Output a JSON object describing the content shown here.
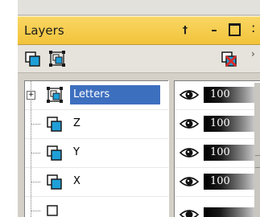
{
  "panel": {
    "title": "Layers",
    "buttons": {
      "pin": "†",
      "minimize": "–",
      "close": "×"
    }
  },
  "toolbar": {
    "icons": [
      "new-layer-icon",
      "new-group-icon",
      "delete-layer-icon"
    ],
    "more": "›"
  },
  "layers": [
    {
      "name": "Letters",
      "expander": "+",
      "selected": true,
      "visible": true,
      "opacity": "100",
      "icon": "group-layer-icon"
    },
    {
      "name": "Z",
      "visible": true,
      "opacity": "100",
      "icon": "vector-layer-icon"
    },
    {
      "name": "Y",
      "visible": true,
      "opacity": "100",
      "icon": "vector-layer-icon"
    },
    {
      "name": "X",
      "visible": true,
      "opacity": "100",
      "icon": "vector-layer-icon"
    }
  ],
  "colors": {
    "title_bar": "#f2c33a",
    "selection": "#3d6fbf",
    "layer_icon_fill": "#1f9fd8",
    "delete_icon": "#d82b2b"
  }
}
